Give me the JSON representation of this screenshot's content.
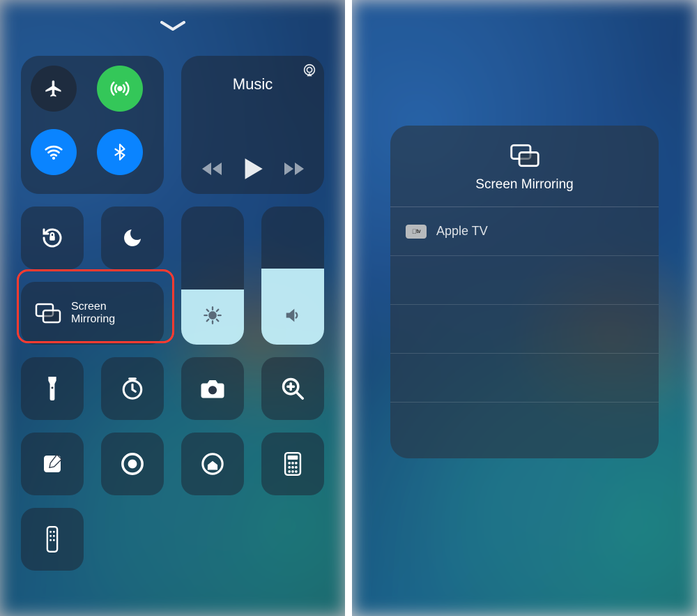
{
  "control_center": {
    "music_label": "Music",
    "screen_mirroring_label": "Screen\nMirroring",
    "brightness_percent": 40,
    "volume_percent": 55
  },
  "popup": {
    "title": "Screen Mirroring",
    "device_badge": "tv",
    "device_name": "Apple TV"
  },
  "icons": {
    "airplane": "airplane-icon",
    "cellular": "cellular-icon",
    "wifi": "wifi-icon",
    "bluetooth": "bluetooth-icon",
    "airplay": "airplay-icon",
    "rewind": "rewind-icon",
    "play": "play-icon",
    "forward": "forward-icon",
    "rotation_lock": "rotation-lock-icon",
    "dnd": "do-not-disturb-icon",
    "screen_mirror": "screen-mirroring-icon",
    "brightness": "brightness-icon",
    "volume": "volume-icon",
    "flashlight": "flashlight-icon",
    "timer": "timer-icon",
    "camera": "camera-icon",
    "magnifier": "magnifier-icon",
    "notes": "notes-icon",
    "screen_record": "screen-record-icon",
    "home": "home-icon",
    "calculator": "calculator-icon",
    "remote": "remote-icon"
  }
}
